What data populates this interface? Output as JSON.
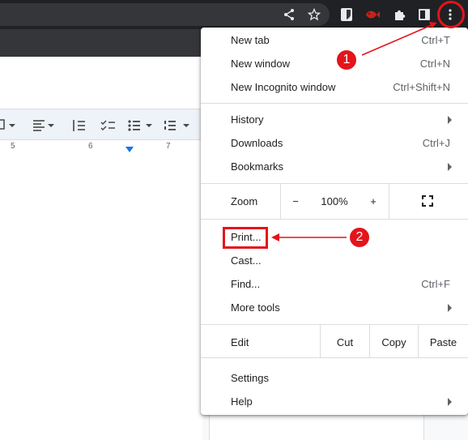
{
  "menu": {
    "items": [
      {
        "label": "New tab",
        "shortcut": "Ctrl+T"
      },
      {
        "label": "New window",
        "shortcut": "Ctrl+N"
      },
      {
        "label": "New Incognito window",
        "shortcut": "Ctrl+Shift+N"
      },
      {
        "label": "History",
        "shortcut": ""
      },
      {
        "label": "Downloads",
        "shortcut": "Ctrl+J"
      },
      {
        "label": "Bookmarks",
        "shortcut": ""
      },
      {
        "label": "Print...",
        "shortcut": ""
      },
      {
        "label": "Cast...",
        "shortcut": ""
      },
      {
        "label": "Find...",
        "shortcut": "Ctrl+F"
      },
      {
        "label": "More tools",
        "shortcut": ""
      },
      {
        "label": "Settings",
        "shortcut": ""
      },
      {
        "label": "Help",
        "shortcut": ""
      }
    ],
    "zoom": {
      "label": "Zoom",
      "minus": "−",
      "value": "100%",
      "plus": "+"
    },
    "edit": {
      "label": "Edit",
      "cut": "Cut",
      "copy": "Copy",
      "paste": "Paste"
    }
  },
  "ruler": {
    "ticks": [
      "5",
      "6",
      "7"
    ]
  },
  "annotations": {
    "step1": "1",
    "step2": "2"
  },
  "colors": {
    "annotation": "#e4141b",
    "toolbar": "#202124"
  },
  "icons": [
    "share-icon",
    "star-icon",
    "bitwarden-icon",
    "fish-extension-icon",
    "puzzle-extension-icon",
    "side-panel-icon",
    "kebab-menu-icon",
    "fullscreen-icon"
  ]
}
